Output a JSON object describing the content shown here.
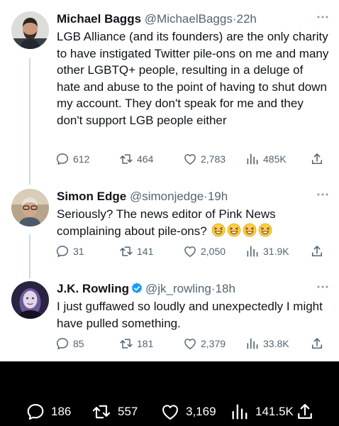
{
  "tweets": [
    {
      "name": "Michael Baggs",
      "handle": "@MichaelBaggs",
      "time": "22h",
      "text": "LGB Alliance (and its founders) are the only charity to have instigated Twitter pile-ons on me and many other LGBTQ+ people, resulting in a deluge of hate and abuse to the point of having to shut down my account. They don't speak for me and they don't support LGB people either",
      "replies": "612",
      "retweets": "464",
      "likes": "2,783",
      "views": "485K"
    },
    {
      "name": "Simon Edge",
      "handle": "@simonjedge",
      "time": "19h",
      "text": "Seriously? The news editor of Pink News complaining about pile-ons?",
      "emojis": [
        "grinning-squinting-face",
        "grinning-squinting-face",
        "grinning-squinting-face",
        "grinning-squinting-face"
      ],
      "replies": "31",
      "retweets": "141",
      "likes": "2,050",
      "views": "31.9K"
    },
    {
      "name": "J.K. Rowling",
      "handle": "@jk_rowling",
      "time": "18h",
      "verified": true,
      "text": "I just guffawed so loudly and unexpectedly I might have pulled something.",
      "replies": "85",
      "retweets": "181",
      "likes": "2,379",
      "views": "33.8K"
    }
  ],
  "bottom_bar": {
    "replies": "186",
    "retweets": "557",
    "likes": "3,169",
    "views": "141.5K"
  },
  "separator": "·",
  "icons": [
    "reply-icon",
    "retweet-icon",
    "like-icon",
    "views-icon",
    "share-icon",
    "more-icon",
    "verified-badge-icon"
  ],
  "colors": {
    "text": "#0f1419",
    "secondary": "#536471",
    "verified": "#1d9bf0",
    "background": "#ffffff",
    "bottom_bar": "#000000"
  }
}
